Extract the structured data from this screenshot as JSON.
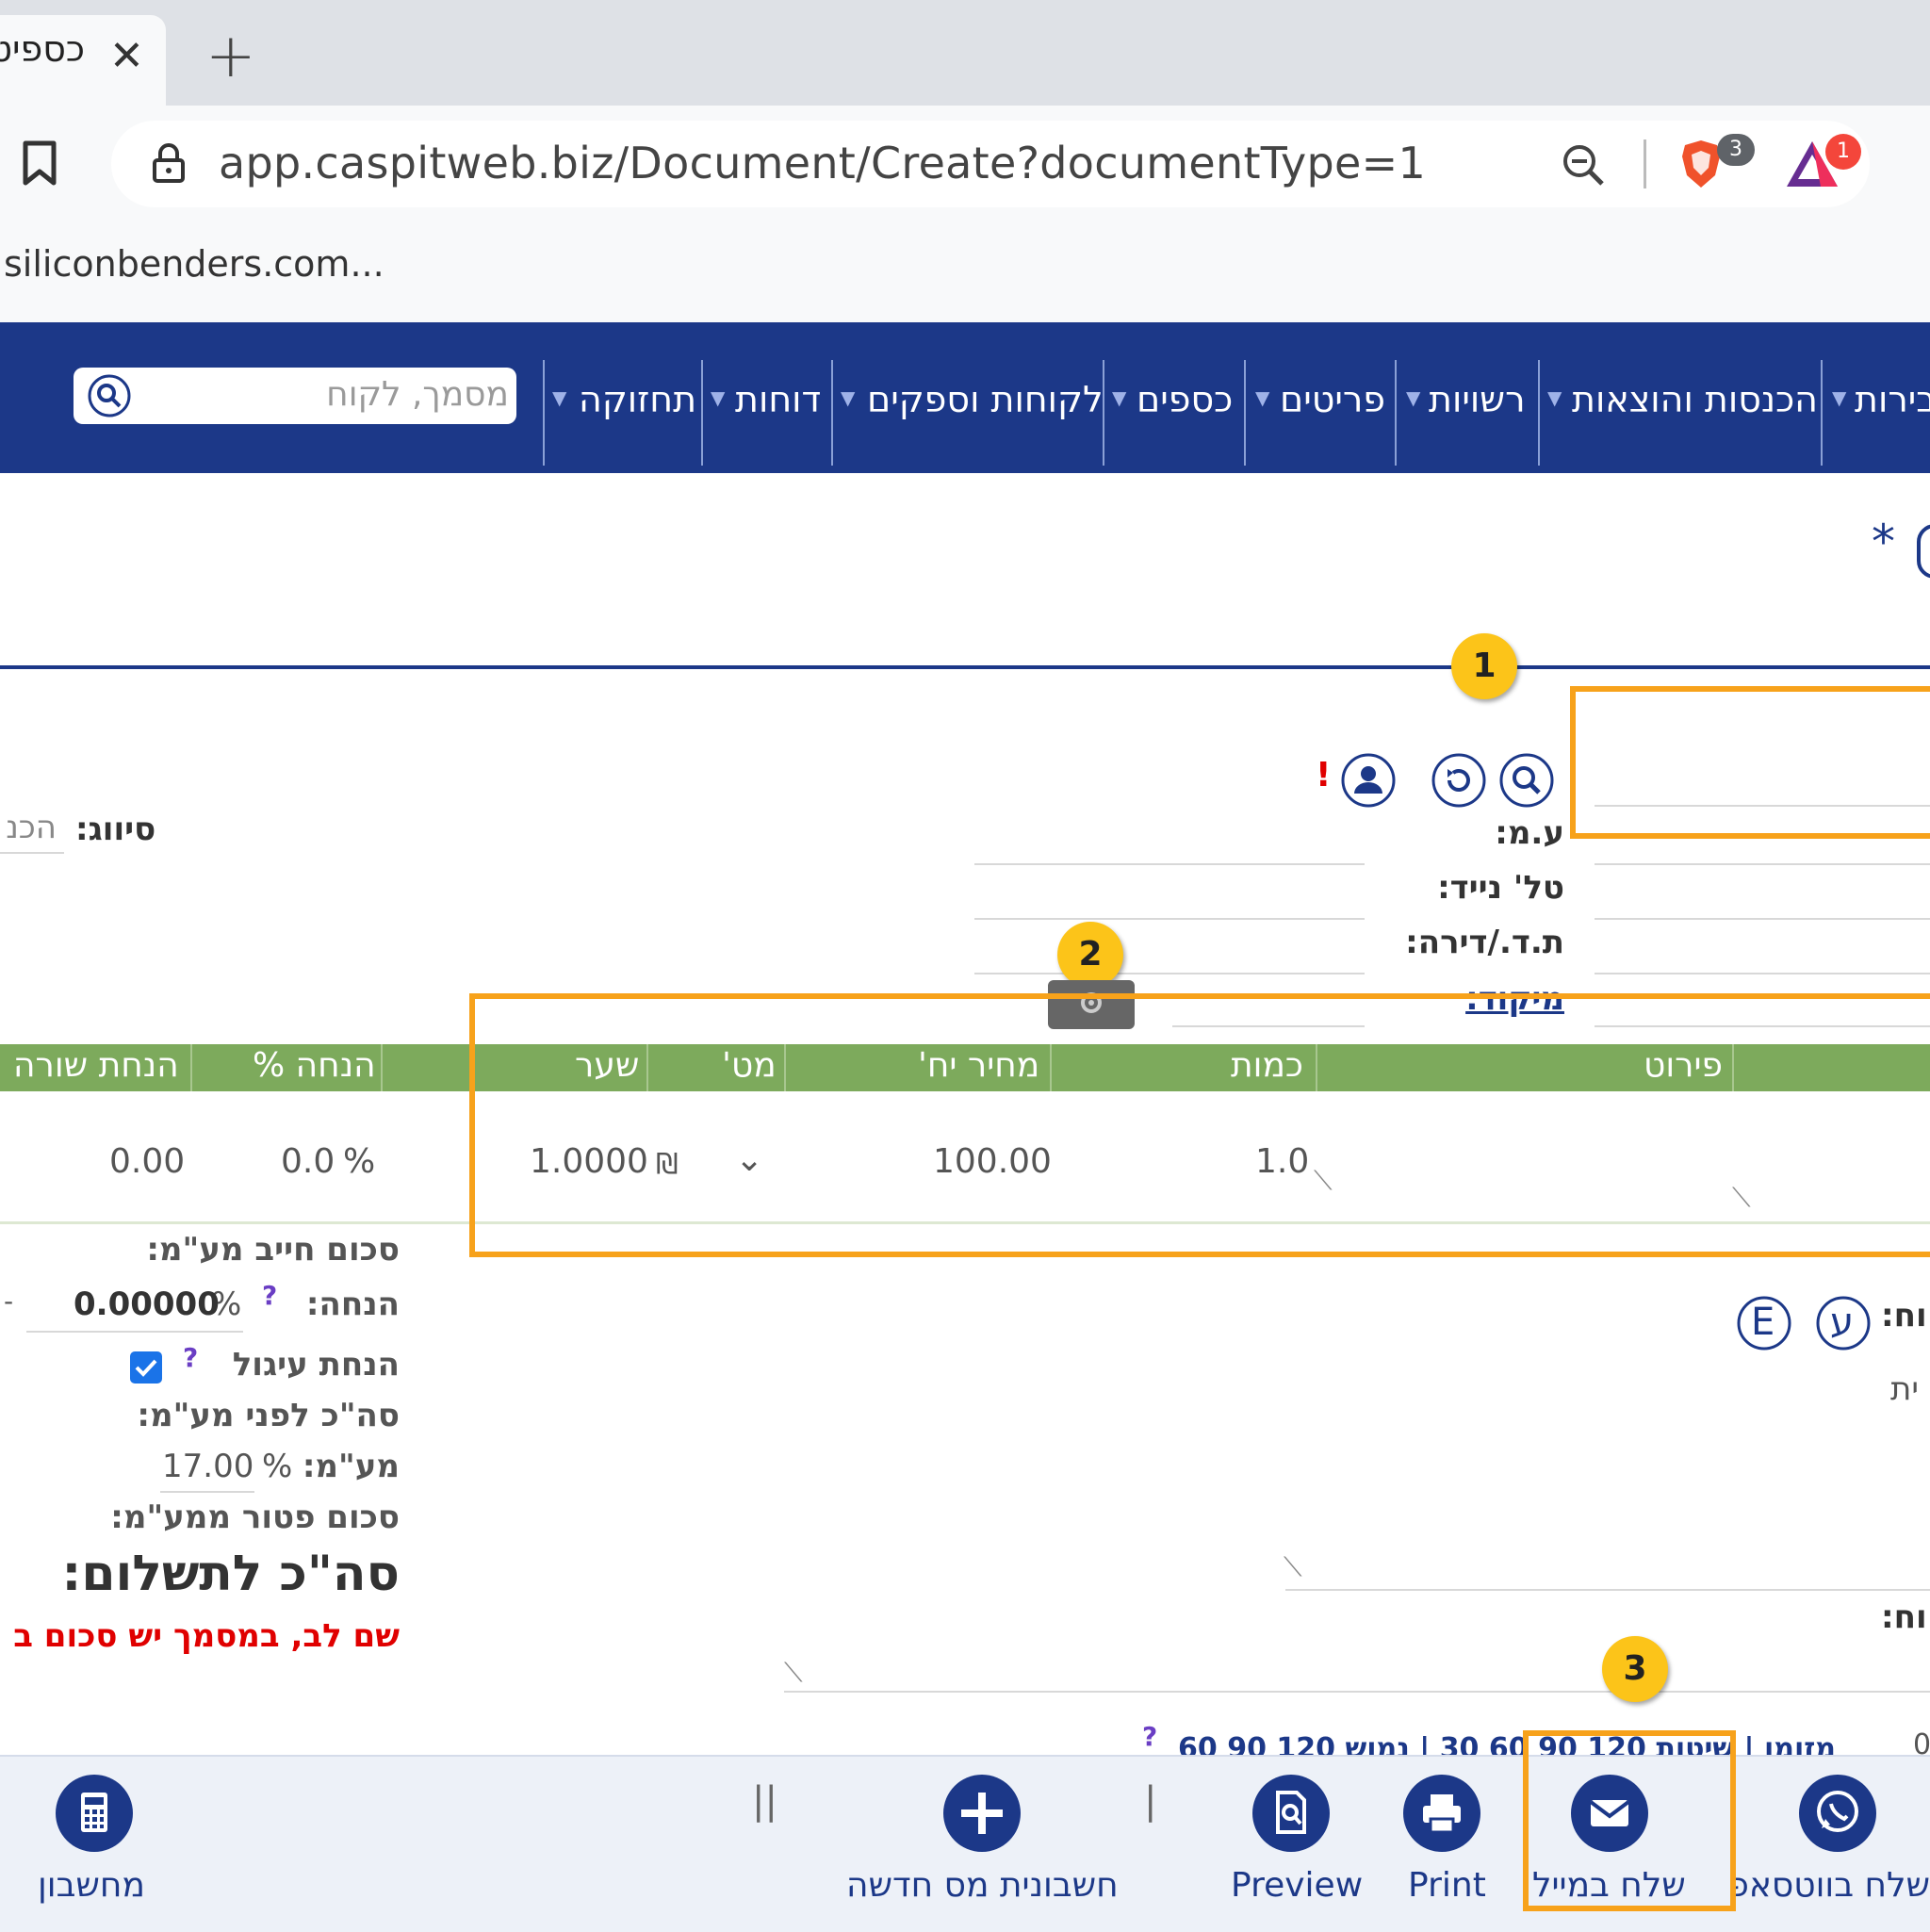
{
  "browser": {
    "tab_title": "כספיט",
    "url": "app.caspitweb.biz/Document/Create?documentType=1",
    "bookmark_item": "siliconbenders.com...",
    "brave_badge": "3",
    "rewards_badge": "1"
  },
  "nav": {
    "items": [
      "בירות",
      "הכנסות והוצאות",
      "רשויות",
      "פריטים",
      "כספים",
      "לקוחות וספקים",
      "דוחות",
      "תחזוקה"
    ],
    "search_placeholder": "מסמך, לקוח"
  },
  "header": {
    "asterisk": "*"
  },
  "callouts": [
    "1",
    "2",
    "3"
  ],
  "customer_form": {
    "vat_id_label": "ע.מ:",
    "mobile_label": "טל' נייד:",
    "pobox_label": "ת.ד./דירה:",
    "zip_label": "מיקוד:",
    "required_mark": "!",
    "category_label": "סיווג:",
    "category_value": "הכנ"
  },
  "table": {
    "headers": [
      "פירוט",
      "כמות",
      "מחיר יח'",
      "מט'",
      "שער",
      "הנחה %",
      "הנחת שורה"
    ],
    "row": {
      "quantity": "1.0",
      "unit_price": "100.00",
      "currency": "₪",
      "rate": "1.0000",
      "discount_pct": "0.0",
      "percent_sign": "%",
      "line_discount": "0.00"
    }
  },
  "totals": {
    "vat_liable_label": "סכום חייב מע\"מ:",
    "discount_label": "הנחה:",
    "discount_value": "0.00000",
    "percent_sign": "%",
    "help_mark": "?",
    "rounding_label": "הנחת עיגול",
    "rounding_checked": true,
    "before_vat_label": "סה\"כ לפני מע\"מ:",
    "vat_label": "מע\"מ:",
    "vat_value": "17.00",
    "exempt_label": "סכום פטור ממע\"מ:",
    "total_label": "סה\"כ לתשלום:",
    "warning": "שם לב, במסמך יש סכום ב",
    "dash": "-"
  },
  "notes": {
    "label_1": ":וח",
    "label_2": "ית",
    "label_3": ":וח",
    "letter_e": "E",
    "letter_ayin": "ע"
  },
  "contact_line": "מזומן | שיטות 120 90 60 30 | נמוש 120 90 60 30",
  "zero_text": "0",
  "actions": {
    "whatsapp": "שלח בווטסאפ",
    "email": "שלח במייל",
    "print": "Print",
    "preview": "Preview",
    "new_invoice": "חשבונית מס חדשה",
    "calculator": "מחשבון",
    "sep_single": "|",
    "sep_double": "||"
  },
  "colors": {
    "nav_bg": "#1c3888",
    "table_header": "#7daa5c",
    "highlight": "#f7a21b",
    "badge": "#fcc419",
    "warning": "#e00000"
  }
}
